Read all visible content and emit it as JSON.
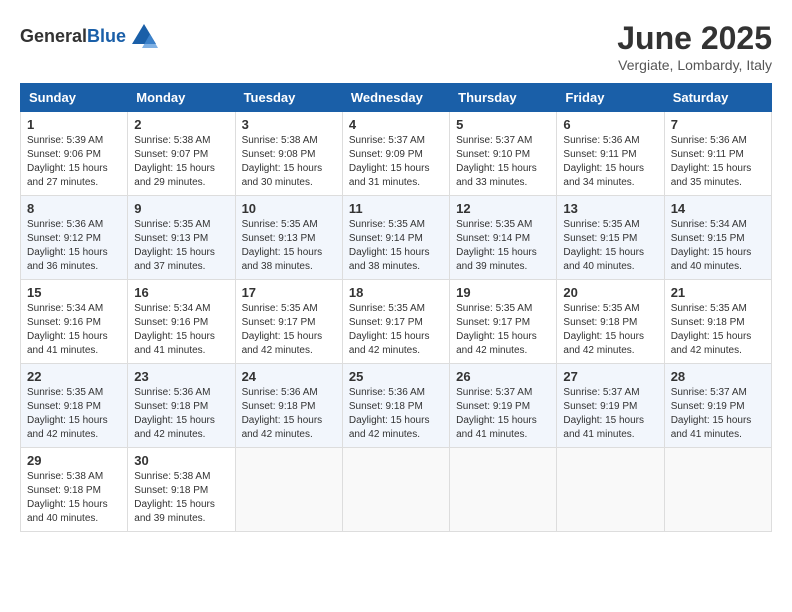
{
  "header": {
    "logo_general": "General",
    "logo_blue": "Blue",
    "month_title": "June 2025",
    "location": "Vergiate, Lombardy, Italy"
  },
  "days_of_week": [
    "Sunday",
    "Monday",
    "Tuesday",
    "Wednesday",
    "Thursday",
    "Friday",
    "Saturday"
  ],
  "weeks": [
    [
      {
        "day": "1",
        "sunrise": "Sunrise: 5:39 AM",
        "sunset": "Sunset: 9:06 PM",
        "daylight": "Daylight: 15 hours and 27 minutes."
      },
      {
        "day": "2",
        "sunrise": "Sunrise: 5:38 AM",
        "sunset": "Sunset: 9:07 PM",
        "daylight": "Daylight: 15 hours and 29 minutes."
      },
      {
        "day": "3",
        "sunrise": "Sunrise: 5:38 AM",
        "sunset": "Sunset: 9:08 PM",
        "daylight": "Daylight: 15 hours and 30 minutes."
      },
      {
        "day": "4",
        "sunrise": "Sunrise: 5:37 AM",
        "sunset": "Sunset: 9:09 PM",
        "daylight": "Daylight: 15 hours and 31 minutes."
      },
      {
        "day": "5",
        "sunrise": "Sunrise: 5:37 AM",
        "sunset": "Sunset: 9:10 PM",
        "daylight": "Daylight: 15 hours and 33 minutes."
      },
      {
        "day": "6",
        "sunrise": "Sunrise: 5:36 AM",
        "sunset": "Sunset: 9:11 PM",
        "daylight": "Daylight: 15 hours and 34 minutes."
      },
      {
        "day": "7",
        "sunrise": "Sunrise: 5:36 AM",
        "sunset": "Sunset: 9:11 PM",
        "daylight": "Daylight: 15 hours and 35 minutes."
      }
    ],
    [
      {
        "day": "8",
        "sunrise": "Sunrise: 5:36 AM",
        "sunset": "Sunset: 9:12 PM",
        "daylight": "Daylight: 15 hours and 36 minutes."
      },
      {
        "day": "9",
        "sunrise": "Sunrise: 5:35 AM",
        "sunset": "Sunset: 9:13 PM",
        "daylight": "Daylight: 15 hours and 37 minutes."
      },
      {
        "day": "10",
        "sunrise": "Sunrise: 5:35 AM",
        "sunset": "Sunset: 9:13 PM",
        "daylight": "Daylight: 15 hours and 38 minutes."
      },
      {
        "day": "11",
        "sunrise": "Sunrise: 5:35 AM",
        "sunset": "Sunset: 9:14 PM",
        "daylight": "Daylight: 15 hours and 38 minutes."
      },
      {
        "day": "12",
        "sunrise": "Sunrise: 5:35 AM",
        "sunset": "Sunset: 9:14 PM",
        "daylight": "Daylight: 15 hours and 39 minutes."
      },
      {
        "day": "13",
        "sunrise": "Sunrise: 5:35 AM",
        "sunset": "Sunset: 9:15 PM",
        "daylight": "Daylight: 15 hours and 40 minutes."
      },
      {
        "day": "14",
        "sunrise": "Sunrise: 5:34 AM",
        "sunset": "Sunset: 9:15 PM",
        "daylight": "Daylight: 15 hours and 40 minutes."
      }
    ],
    [
      {
        "day": "15",
        "sunrise": "Sunrise: 5:34 AM",
        "sunset": "Sunset: 9:16 PM",
        "daylight": "Daylight: 15 hours and 41 minutes."
      },
      {
        "day": "16",
        "sunrise": "Sunrise: 5:34 AM",
        "sunset": "Sunset: 9:16 PM",
        "daylight": "Daylight: 15 hours and 41 minutes."
      },
      {
        "day": "17",
        "sunrise": "Sunrise: 5:35 AM",
        "sunset": "Sunset: 9:17 PM",
        "daylight": "Daylight: 15 hours and 42 minutes."
      },
      {
        "day": "18",
        "sunrise": "Sunrise: 5:35 AM",
        "sunset": "Sunset: 9:17 PM",
        "daylight": "Daylight: 15 hours and 42 minutes."
      },
      {
        "day": "19",
        "sunrise": "Sunrise: 5:35 AM",
        "sunset": "Sunset: 9:17 PM",
        "daylight": "Daylight: 15 hours and 42 minutes."
      },
      {
        "day": "20",
        "sunrise": "Sunrise: 5:35 AM",
        "sunset": "Sunset: 9:18 PM",
        "daylight": "Daylight: 15 hours and 42 minutes."
      },
      {
        "day": "21",
        "sunrise": "Sunrise: 5:35 AM",
        "sunset": "Sunset: 9:18 PM",
        "daylight": "Daylight: 15 hours and 42 minutes."
      }
    ],
    [
      {
        "day": "22",
        "sunrise": "Sunrise: 5:35 AM",
        "sunset": "Sunset: 9:18 PM",
        "daylight": "Daylight: 15 hours and 42 minutes."
      },
      {
        "day": "23",
        "sunrise": "Sunrise: 5:36 AM",
        "sunset": "Sunset: 9:18 PM",
        "daylight": "Daylight: 15 hours and 42 minutes."
      },
      {
        "day": "24",
        "sunrise": "Sunrise: 5:36 AM",
        "sunset": "Sunset: 9:18 PM",
        "daylight": "Daylight: 15 hours and 42 minutes."
      },
      {
        "day": "25",
        "sunrise": "Sunrise: 5:36 AM",
        "sunset": "Sunset: 9:18 PM",
        "daylight": "Daylight: 15 hours and 42 minutes."
      },
      {
        "day": "26",
        "sunrise": "Sunrise: 5:37 AM",
        "sunset": "Sunset: 9:19 PM",
        "daylight": "Daylight: 15 hours and 41 minutes."
      },
      {
        "day": "27",
        "sunrise": "Sunrise: 5:37 AM",
        "sunset": "Sunset: 9:19 PM",
        "daylight": "Daylight: 15 hours and 41 minutes."
      },
      {
        "day": "28",
        "sunrise": "Sunrise: 5:37 AM",
        "sunset": "Sunset: 9:19 PM",
        "daylight": "Daylight: 15 hours and 41 minutes."
      }
    ],
    [
      {
        "day": "29",
        "sunrise": "Sunrise: 5:38 AM",
        "sunset": "Sunset: 9:18 PM",
        "daylight": "Daylight: 15 hours and 40 minutes."
      },
      {
        "day": "30",
        "sunrise": "Sunrise: 5:38 AM",
        "sunset": "Sunset: 9:18 PM",
        "daylight": "Daylight: 15 hours and 39 minutes."
      },
      null,
      null,
      null,
      null,
      null
    ]
  ]
}
